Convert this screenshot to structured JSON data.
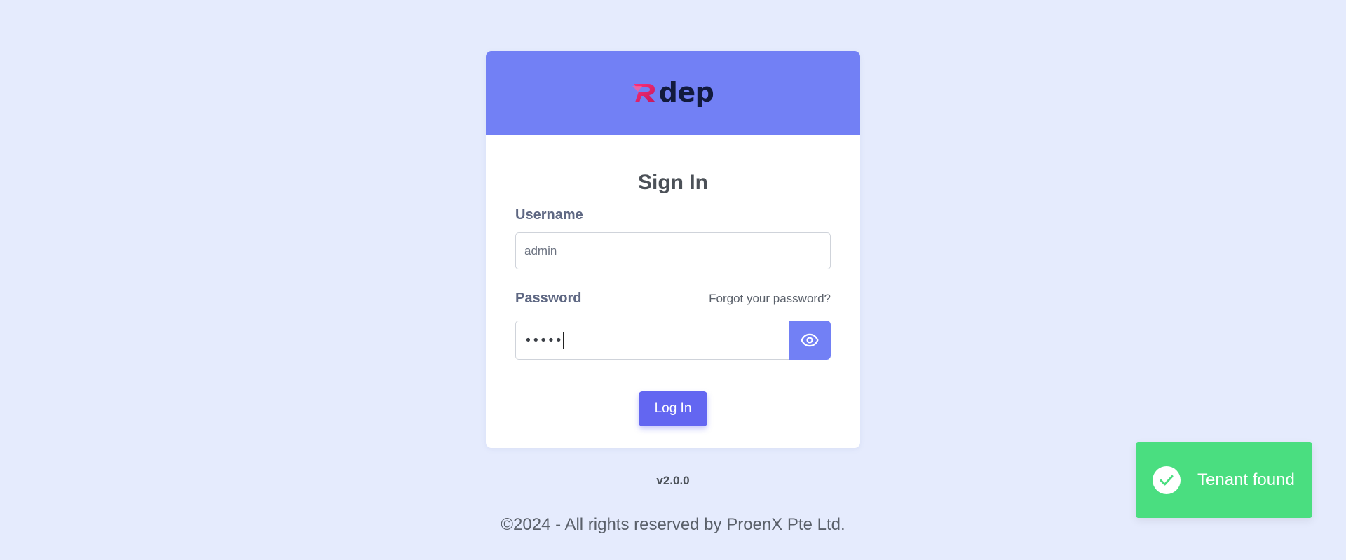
{
  "brand": {
    "logo_text": "dep",
    "header_color": "#7280f5"
  },
  "login": {
    "title": "Sign In",
    "username_label": "Username",
    "username_value": "admin",
    "password_label": "Password",
    "forgot_label": "Forgot your password?",
    "password_masked": "•••••",
    "toggle_icon": "eye-icon",
    "login_button": "Log In",
    "accent_color": "#6366f1"
  },
  "footer": {
    "version": "v2.0.0",
    "copyright": "©2024 - All rights reserved by ProenX Pte Ltd."
  },
  "toast": {
    "message": "Tenant found",
    "icon": "check-circle-icon",
    "color": "#4ade80"
  }
}
